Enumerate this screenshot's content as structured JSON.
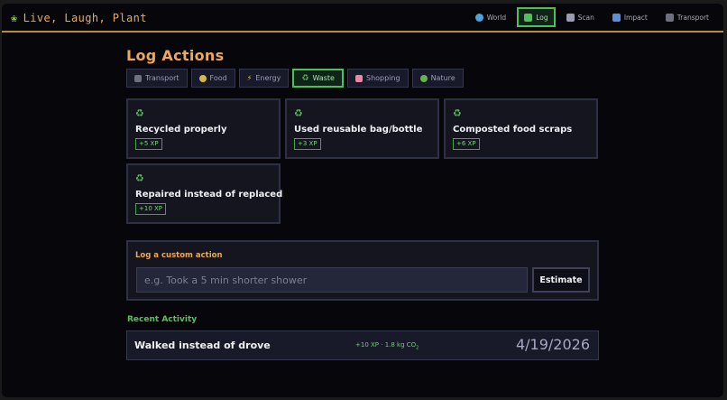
{
  "app": {
    "title": "Live, Laugh, Plant",
    "brand_icon": "sprout-icon"
  },
  "nav": [
    {
      "label": "World",
      "icon": "globe-icon",
      "color": "#4aa3df",
      "active": false
    },
    {
      "label": "Log",
      "icon": "check-box-icon",
      "color": "#4fbf58",
      "active": true
    },
    {
      "label": "Scan",
      "icon": "camera-icon",
      "color": "#9a9ab0",
      "active": false
    },
    {
      "label": "Impact",
      "icon": "bar-chart-icon",
      "color": "#5d8fd8",
      "active": false
    },
    {
      "label": "Transport",
      "icon": "car-icon",
      "color": "#6e7080",
      "active": false
    }
  ],
  "page": {
    "title": "Log Actions"
  },
  "tabs": [
    {
      "label": "Transport",
      "icon": "car-icon",
      "color": "#6e7080",
      "active": false
    },
    {
      "label": "Food",
      "icon": "food-icon",
      "color": "#d8b84a",
      "active": false
    },
    {
      "label": "Energy",
      "icon": "lightning-icon",
      "color": "#f3c330",
      "active": false
    },
    {
      "label": "Waste",
      "icon": "recycle-icon",
      "color": "#4fbf58",
      "active": true
    },
    {
      "label": "Shopping",
      "icon": "shopping-bag-icon",
      "color": "#e58aa4",
      "active": false
    },
    {
      "label": "Nature",
      "icon": "tree-icon",
      "color": "#69b34c",
      "active": false
    }
  ],
  "actions": [
    {
      "label": "Recycled properly",
      "xp": "+5 XP",
      "icon": "recycle-icon"
    },
    {
      "label": "Used reusable bag/bottle",
      "xp": "+3 XP",
      "icon": "recycle-icon"
    },
    {
      "label": "Composted food scraps",
      "xp": "+6 XP",
      "icon": "recycle-icon"
    },
    {
      "label": "Repaired instead of replaced",
      "xp": "+10 XP",
      "icon": "recycle-icon"
    }
  ],
  "custom": {
    "title": "Log a custom action",
    "placeholder": "e.g. Took a 5 min shorter shower",
    "value": "",
    "button_label": "Estimate"
  },
  "recent": {
    "title": "Recent Activity",
    "items": [
      {
        "label": "Walked instead of drove",
        "meta": "+10 XP · 1.8 kg CO",
        "meta_sub": "2",
        "date": "4/19/2026"
      }
    ]
  },
  "colors": {
    "accent_orange": "#eea760",
    "accent_green": "#4fbf58",
    "background": "#07070b"
  }
}
